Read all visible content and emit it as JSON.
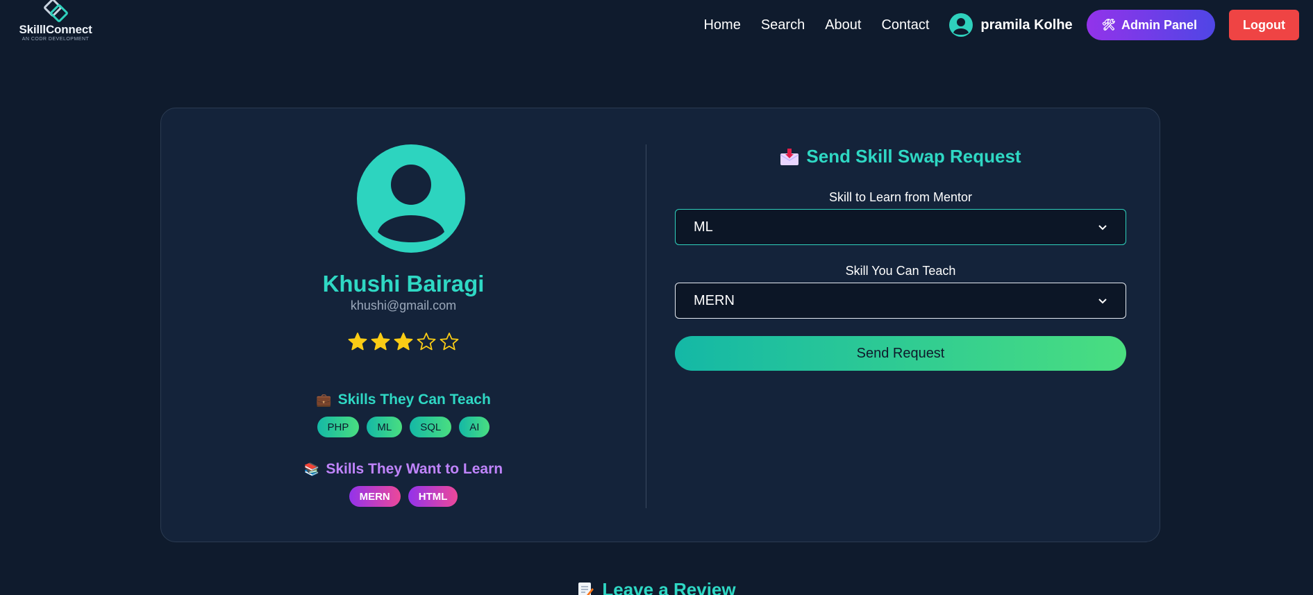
{
  "brand": {
    "name": "SkilllConnect",
    "tagline": "AN CODR DEVELOPMENT"
  },
  "nav": {
    "links": [
      "Home",
      "Search",
      "About",
      "Contact"
    ],
    "user_name": "pramila Kolhe",
    "admin_label": "Admin Panel",
    "logout_label": "Logout"
  },
  "profile": {
    "name": "Khushi Bairagi",
    "email": "khushi@gmail.com",
    "rating": 3,
    "rating_max": 5,
    "teach_title": "Skills They Can Teach",
    "teach_skills": [
      "PHP",
      "ML",
      "SQL",
      "AI"
    ],
    "learn_title": "Skills They Want to Learn",
    "learn_skills": [
      "MERN",
      "HTML"
    ]
  },
  "request": {
    "title": "Send Skill Swap Request",
    "learn_label": "Skill to Learn from Mentor",
    "learn_selected": "ML",
    "teach_label": "Skill You Can Teach",
    "teach_selected": "MERN",
    "send_label": "Send Request"
  },
  "review": {
    "title": "Leave a Review"
  },
  "colors": {
    "accent": "#2fd8c4",
    "star": "#facc15",
    "logout": "#ef4444",
    "background": "#0f1b2d"
  }
}
